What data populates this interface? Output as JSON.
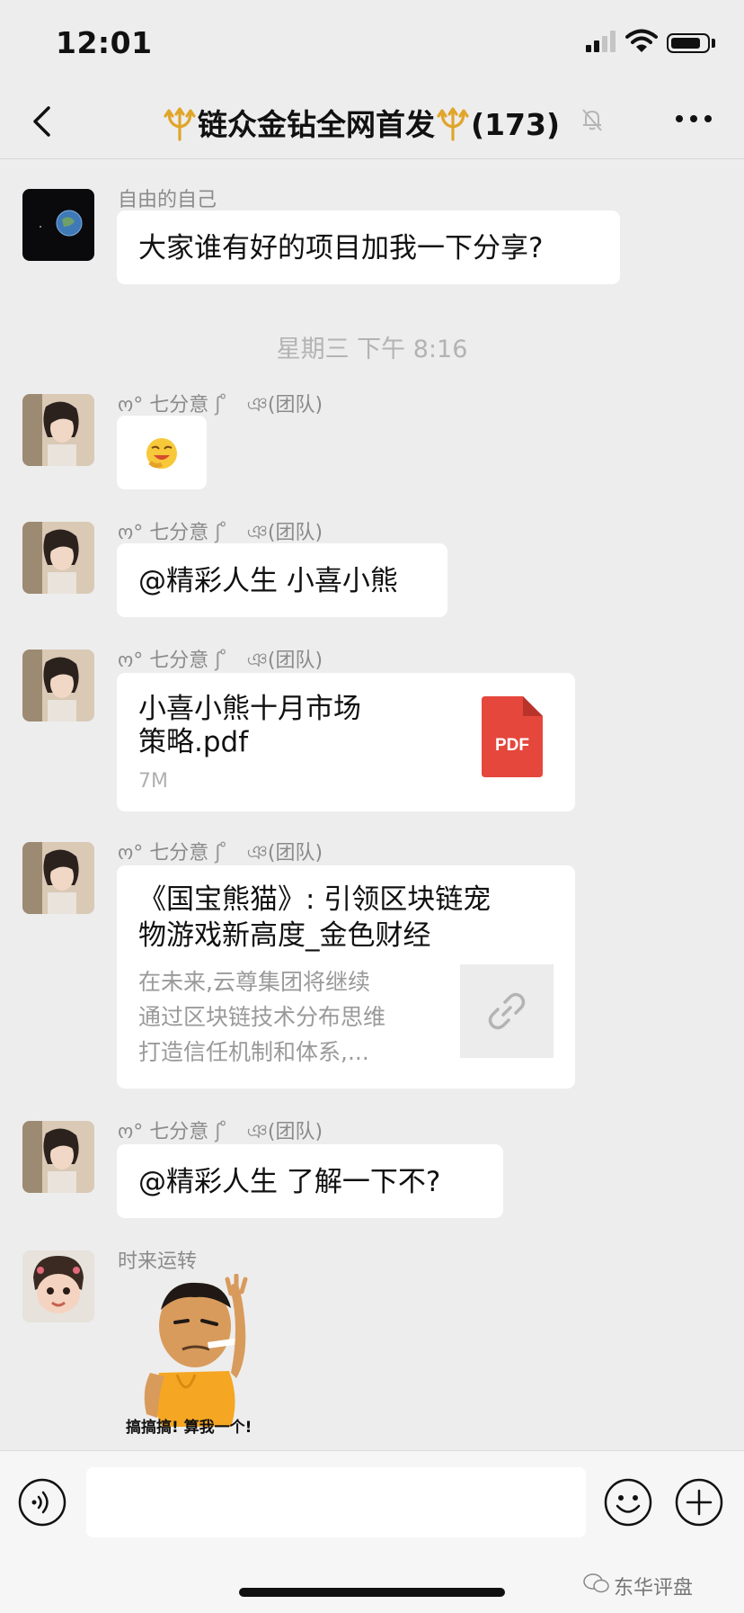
{
  "status_bar": {
    "time": "12:01"
  },
  "nav": {
    "title": "链众金钻全网首发",
    "member_count": "(173)"
  },
  "messages": [
    {
      "sender": "自由的自己",
      "text": "大家谁有好的项目加我一下分享?"
    },
    {
      "sender": "ო° 七分意",
      "tag": "ঞ(团队)"
    },
    {
      "sender": "ო° 七分意",
      "tag": "ঞ(团队)",
      "text": "@精彩人生 小喜小熊"
    },
    {
      "sender": "ო° 七分意",
      "tag": "ঞ(团队)",
      "file_name_line1": "小喜小熊十月市场",
      "file_name_line2": "策略.pdf",
      "file_size": "7M",
      "file_icon_label": "PDF"
    },
    {
      "sender": "ო° 七分意",
      "tag": "ঞ(团队)",
      "link_title_line1": "《国宝熊猫》: 引领区块链宠",
      "link_title_line2": "物游戏新高度_金色财经",
      "link_desc_line1": "在未来,云尊集团将继续",
      "link_desc_line2": "通过区块链技术分布思维",
      "link_desc_line3": "打造信任机制和体系,..."
    },
    {
      "sender": "ო° 七分意",
      "tag": "ঞ(团队)",
      "text": "@精彩人生 了解一下不?"
    },
    {
      "sender": "时来运转",
      "sticker_caption": "搞搞搞! 算我一个!"
    }
  ],
  "timestamp": "星期三 下午 8:16",
  "watermark": "东华评盘",
  "colors": {
    "background": "#ededed",
    "bubble": "#ffffff",
    "pdf_red": "#e5473d",
    "meta_text": "#8b8b8b"
  },
  "icons": [
    "back-arrow-icon",
    "trident-icon",
    "mute-bell-icon",
    "more-dots-icon",
    "voice-icon",
    "emoji-icon",
    "plus-icon",
    "link-icon",
    "pdf-icon"
  ]
}
